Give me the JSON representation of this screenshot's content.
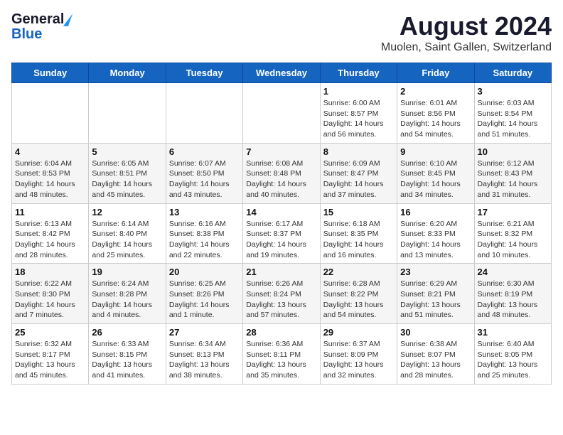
{
  "header": {
    "logo_general": "General",
    "logo_blue": "Blue",
    "title": "August 2024",
    "subtitle": "Muolen, Saint Gallen, Switzerland"
  },
  "days_of_week": [
    "Sunday",
    "Monday",
    "Tuesday",
    "Wednesday",
    "Thursday",
    "Friday",
    "Saturday"
  ],
  "weeks": [
    [
      {
        "day": "",
        "info": ""
      },
      {
        "day": "",
        "info": ""
      },
      {
        "day": "",
        "info": ""
      },
      {
        "day": "",
        "info": ""
      },
      {
        "day": "1",
        "info": "Sunrise: 6:00 AM\nSunset: 8:57 PM\nDaylight: 14 hours and 56 minutes."
      },
      {
        "day": "2",
        "info": "Sunrise: 6:01 AM\nSunset: 8:56 PM\nDaylight: 14 hours and 54 minutes."
      },
      {
        "day": "3",
        "info": "Sunrise: 6:03 AM\nSunset: 8:54 PM\nDaylight: 14 hours and 51 minutes."
      }
    ],
    [
      {
        "day": "4",
        "info": "Sunrise: 6:04 AM\nSunset: 8:53 PM\nDaylight: 14 hours and 48 minutes."
      },
      {
        "day": "5",
        "info": "Sunrise: 6:05 AM\nSunset: 8:51 PM\nDaylight: 14 hours and 45 minutes."
      },
      {
        "day": "6",
        "info": "Sunrise: 6:07 AM\nSunset: 8:50 PM\nDaylight: 14 hours and 43 minutes."
      },
      {
        "day": "7",
        "info": "Sunrise: 6:08 AM\nSunset: 8:48 PM\nDaylight: 14 hours and 40 minutes."
      },
      {
        "day": "8",
        "info": "Sunrise: 6:09 AM\nSunset: 8:47 PM\nDaylight: 14 hours and 37 minutes."
      },
      {
        "day": "9",
        "info": "Sunrise: 6:10 AM\nSunset: 8:45 PM\nDaylight: 14 hours and 34 minutes."
      },
      {
        "day": "10",
        "info": "Sunrise: 6:12 AM\nSunset: 8:43 PM\nDaylight: 14 hours and 31 minutes."
      }
    ],
    [
      {
        "day": "11",
        "info": "Sunrise: 6:13 AM\nSunset: 8:42 PM\nDaylight: 14 hours and 28 minutes."
      },
      {
        "day": "12",
        "info": "Sunrise: 6:14 AM\nSunset: 8:40 PM\nDaylight: 14 hours and 25 minutes."
      },
      {
        "day": "13",
        "info": "Sunrise: 6:16 AM\nSunset: 8:38 PM\nDaylight: 14 hours and 22 minutes."
      },
      {
        "day": "14",
        "info": "Sunrise: 6:17 AM\nSunset: 8:37 PM\nDaylight: 14 hours and 19 minutes."
      },
      {
        "day": "15",
        "info": "Sunrise: 6:18 AM\nSunset: 8:35 PM\nDaylight: 14 hours and 16 minutes."
      },
      {
        "day": "16",
        "info": "Sunrise: 6:20 AM\nSunset: 8:33 PM\nDaylight: 14 hours and 13 minutes."
      },
      {
        "day": "17",
        "info": "Sunrise: 6:21 AM\nSunset: 8:32 PM\nDaylight: 14 hours and 10 minutes."
      }
    ],
    [
      {
        "day": "18",
        "info": "Sunrise: 6:22 AM\nSunset: 8:30 PM\nDaylight: 14 hours and 7 minutes."
      },
      {
        "day": "19",
        "info": "Sunrise: 6:24 AM\nSunset: 8:28 PM\nDaylight: 14 hours and 4 minutes."
      },
      {
        "day": "20",
        "info": "Sunrise: 6:25 AM\nSunset: 8:26 PM\nDaylight: 14 hours and 1 minute."
      },
      {
        "day": "21",
        "info": "Sunrise: 6:26 AM\nSunset: 8:24 PM\nDaylight: 13 hours and 57 minutes."
      },
      {
        "day": "22",
        "info": "Sunrise: 6:28 AM\nSunset: 8:22 PM\nDaylight: 13 hours and 54 minutes."
      },
      {
        "day": "23",
        "info": "Sunrise: 6:29 AM\nSunset: 8:21 PM\nDaylight: 13 hours and 51 minutes."
      },
      {
        "day": "24",
        "info": "Sunrise: 6:30 AM\nSunset: 8:19 PM\nDaylight: 13 hours and 48 minutes."
      }
    ],
    [
      {
        "day": "25",
        "info": "Sunrise: 6:32 AM\nSunset: 8:17 PM\nDaylight: 13 hours and 45 minutes."
      },
      {
        "day": "26",
        "info": "Sunrise: 6:33 AM\nSunset: 8:15 PM\nDaylight: 13 hours and 41 minutes."
      },
      {
        "day": "27",
        "info": "Sunrise: 6:34 AM\nSunset: 8:13 PM\nDaylight: 13 hours and 38 minutes."
      },
      {
        "day": "28",
        "info": "Sunrise: 6:36 AM\nSunset: 8:11 PM\nDaylight: 13 hours and 35 minutes."
      },
      {
        "day": "29",
        "info": "Sunrise: 6:37 AM\nSunset: 8:09 PM\nDaylight: 13 hours and 32 minutes."
      },
      {
        "day": "30",
        "info": "Sunrise: 6:38 AM\nSunset: 8:07 PM\nDaylight: 13 hours and 28 minutes."
      },
      {
        "day": "31",
        "info": "Sunrise: 6:40 AM\nSunset: 8:05 PM\nDaylight: 13 hours and 25 minutes."
      }
    ]
  ]
}
